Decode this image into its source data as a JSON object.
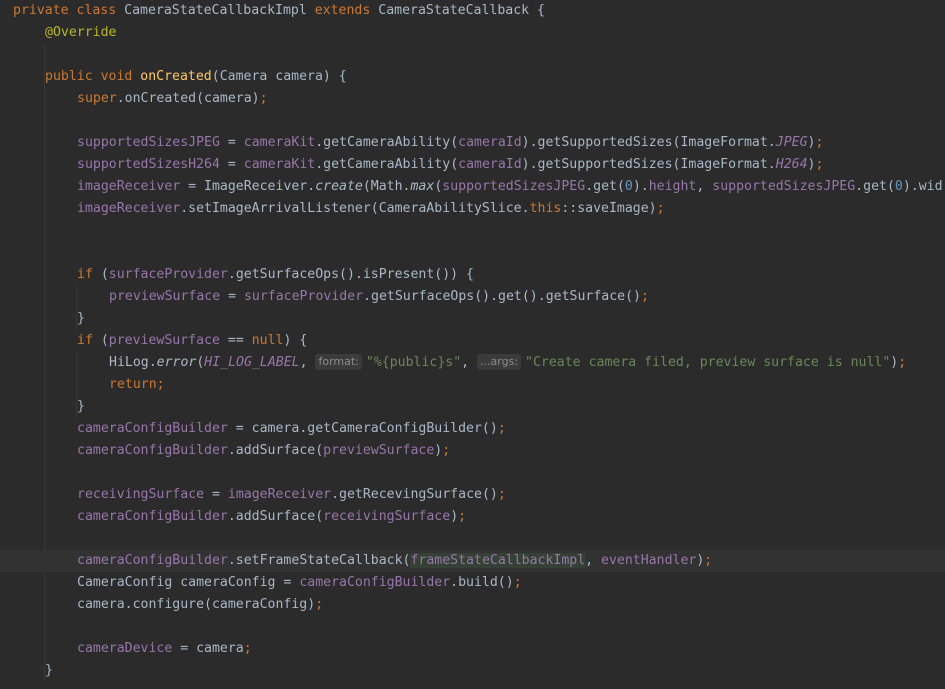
{
  "colors": {
    "background": "#2b2b2b",
    "keyword": "#cc7832",
    "annotation": "#bbb529",
    "method_declaration": "#ffc66d",
    "field": "#9876aa",
    "string": "#6a8759",
    "number": "#6897bb",
    "default_text": "#a9b7c6",
    "inlay_hint": "#8c8c8c"
  },
  "code": {
    "l1": {
      "kw1": "private ",
      "kw2": "class ",
      "cls": "CameraStateCallbackImpl ",
      "kw3": "extends ",
      "parent": "CameraStateCallback {"
    },
    "l2": {
      "annotation": "@Override"
    },
    "l3": {
      "kw1": "public ",
      "kw2": "void ",
      "method": "onCreated",
      "params": "(Camera camera) {"
    },
    "l4": {
      "kw": "super",
      "rest": ".onCreated(camera)",
      "semi": ";"
    },
    "l5": {
      "f1": "supportedSizesJPEG",
      "t1": " = ",
      "f2": "cameraKit",
      "t2": ".getCameraAbility(",
      "f3": "cameraId",
      "t3": ").getSupportedSizes(ImageFormat.",
      "c1": "JPEG",
      "t4": ")",
      "semi": ";"
    },
    "l6": {
      "f1": "supportedSizesH264",
      "t1": " = ",
      "f2": "cameraKit",
      "t2": ".getCameraAbility(",
      "f3": "cameraId",
      "t3": ").getSupportedSizes(ImageFormat.",
      "c1": "H264",
      "t4": ")",
      "semi": ";"
    },
    "l7": {
      "f1": "imageReceiver",
      "t1": " = ImageReceiver.",
      "m1": "create",
      "t2": "(Math.",
      "m2": "max",
      "t3": "(",
      "f2": "supportedSizesJPEG",
      "t4": ".get(",
      "n1": "0",
      "t5": ").",
      "f3": "height",
      "t6": ", ",
      "f4": "supportedSizesJPEG",
      "t7": ".get(",
      "n2": "0",
      "t8": ").wid"
    },
    "l8": {
      "f1": "imageReceiver",
      "t1": ".setImageArrivalListener(CameraAbilitySlice.",
      "kw": "this",
      "t2": "::saveImage)",
      "semi": ";"
    },
    "l9": {
      "kw": "if ",
      "t1": "(",
      "f1": "surfaceProvider",
      "t2": ".getSurfaceOps().isPresent()) {"
    },
    "l10": {
      "f1": "previewSurface",
      "t1": " = ",
      "f2": "surfaceProvider",
      "t2": ".getSurfaceOps().get().getSurface()",
      "semi": ";"
    },
    "l11": {
      "t": "}"
    },
    "l12": {
      "kw": "if ",
      "t1": "(",
      "f1": "previewSurface",
      "t2": " == ",
      "kw2": "null",
      "t3": ") {"
    },
    "l13": {
      "t1": "HiLog.",
      "m1": "error",
      "t2": "(",
      "f1": "HI_LOG_LABEL",
      "t3": ", ",
      "hint1": "format:",
      "s1": "\"%{public}s\"",
      "t4": ", ",
      "hint2": "...args:",
      "s2": "\"Create camera filed, preview surface is null\"",
      "t5": ")",
      "semi": ";"
    },
    "l14": {
      "kw": "return",
      "semi": ";"
    },
    "l15": {
      "t": "}"
    },
    "l16": {
      "f1": "cameraConfigBuilder",
      "t1": " = camera.getCameraConfigBuilder()",
      "semi": ";"
    },
    "l17": {
      "f1": "cameraConfigBuilder",
      "t1": ".addSurface(",
      "f2": "previewSurface",
      "t2": ")",
      "semi": ";"
    },
    "l18": {
      "f1": "receivingSurface",
      "t1": " = ",
      "f2": "imageReceiver",
      "t2": ".getRecevingSurface()",
      "semi": ";"
    },
    "l19": {
      "f1": "cameraConfigBuilder",
      "t1": ".addSurface(",
      "f2": "receivingSurface",
      "t2": ")",
      "semi": ";"
    },
    "l20": {
      "f1": "cameraConfigBuilder",
      "t1": ".setFrameStateCallback(",
      "f2": "frameStateCallbackImpl",
      "t2": ", ",
      "f3": "eventHandler",
      "t3": ")",
      "semi": ";"
    },
    "l21": {
      "t1": "CameraConfig cameraConfig = ",
      "f1": "cameraConfigBuilder",
      "t2": ".build()",
      "semi": ";"
    },
    "l22": {
      "t1": "camera.configure(cameraConfig)",
      "semi": ";"
    },
    "l23": {
      "f1": "cameraDevice",
      "t1": " = camera",
      "semi": ";"
    },
    "l24": {
      "t": "}"
    }
  }
}
